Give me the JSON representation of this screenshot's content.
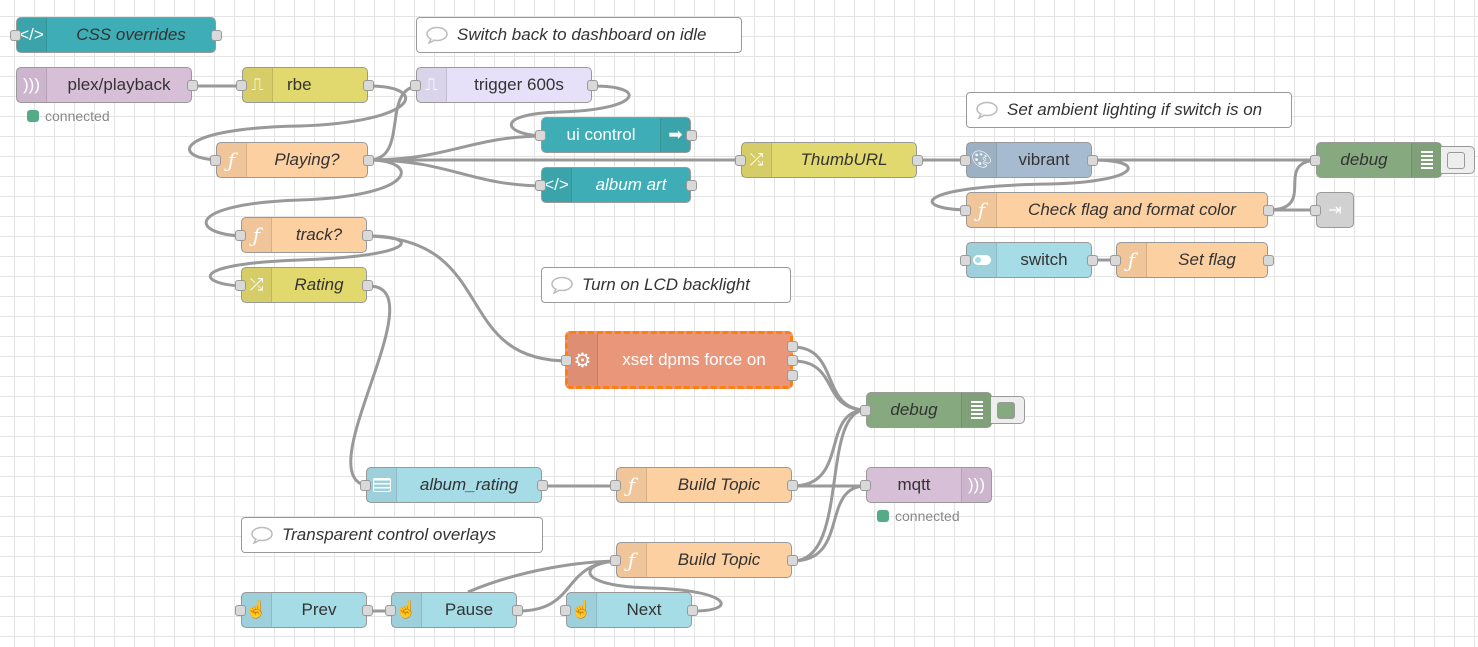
{
  "nodes": {
    "css_overrides": "CSS overrides",
    "plex_playback": "plex/playback",
    "plex_status": "connected",
    "rbe": "rbe",
    "trigger": "trigger 600s",
    "playing": "Playing?",
    "ui_control": "ui control",
    "album_art": "album art",
    "thumburl": "ThumbURL",
    "vibrant": "vibrant",
    "debug": "debug",
    "check_flag": "Check flag and format color",
    "switch": "switch",
    "set_flag": "Set flag",
    "track": "track?",
    "rating": "Rating",
    "xset": "xset dpms force on",
    "album_rating": "album_rating",
    "build_topic_1": "Build Topic",
    "build_topic_2": "Build Topic",
    "mqtt": "mqtt",
    "mqtt_status": "connected",
    "prev": "Prev",
    "pause": "Pause",
    "next": "Next"
  },
  "comments": {
    "idle": "Switch back to dashboard on idle",
    "ambient": "Set ambient lighting if switch is on",
    "lcd": "Turn on LCD backlight",
    "overlays": "Transparent control overlays"
  },
  "colors": {
    "template": "#3fadb5",
    "mqtt": "#d8bfd8",
    "rbe": "#e2d96e",
    "trigger": "#e6e0f8",
    "function": "#fdd0a2",
    "change": "#e2d96e",
    "vibrant": "#a6bbcf",
    "debug": "#87a980",
    "dashboard": "#a6dce6",
    "exec": "#e9967a",
    "selected": "#ff7f0e"
  }
}
